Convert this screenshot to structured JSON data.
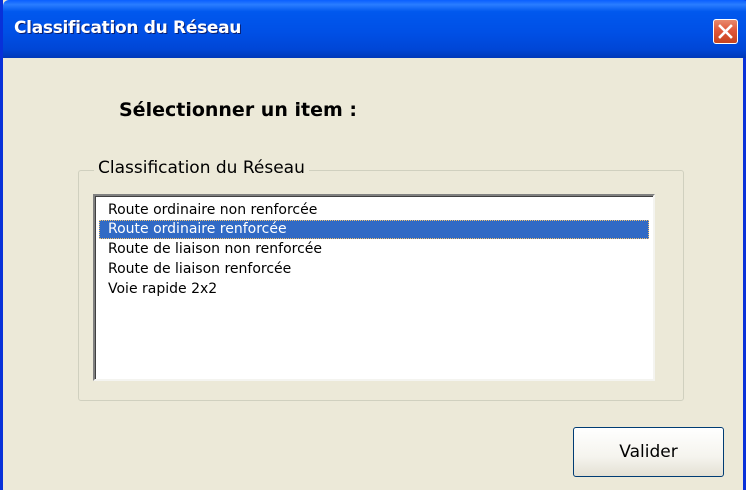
{
  "window": {
    "title": "Classification du Réseau"
  },
  "dialog": {
    "heading": "Sélectionner un item :",
    "group_label": "Classification du Réseau",
    "list": {
      "items": [
        "Route ordinaire non renforcée",
        "Route ordinaire renforcée",
        "Route de liaison non renforcée",
        "Route de liaison renforcée",
        "Voie rapide 2x2"
      ],
      "selected": "Route ordinaire renforcée"
    },
    "submit_label": "Valider"
  },
  "icons": {
    "close": "close-icon"
  },
  "colors": {
    "titlebar": "#0054e3",
    "selection": "#316ac5",
    "close_button": "#e0573a",
    "dialog_background": "#ece9d8"
  }
}
